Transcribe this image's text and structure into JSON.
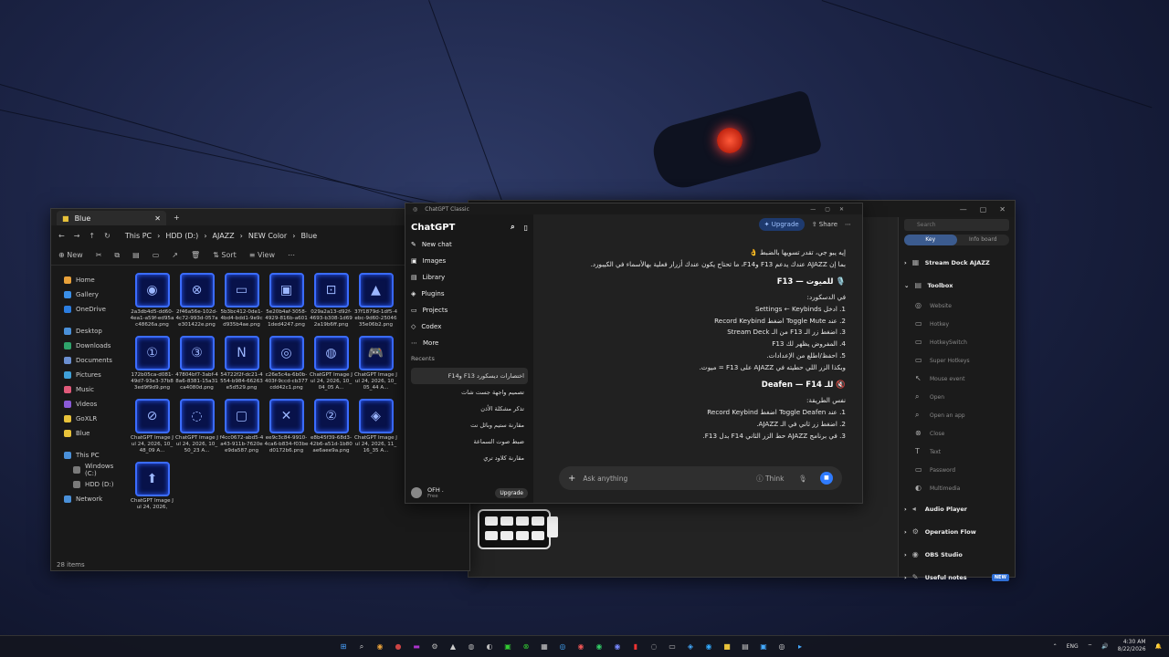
{
  "explorer": {
    "tab_title": "Blue",
    "breadcrumb": [
      "This PC",
      "HDD (D:)",
      "AJAZZ",
      "NEW Color",
      "Blue"
    ],
    "commands": [
      "New",
      "Sort",
      "View"
    ],
    "sidebar": [
      {
        "label": "Home",
        "color": "#e8a13a"
      },
      {
        "label": "Gallery",
        "color": "#3a8fe8"
      },
      {
        "label": "OneDrive",
        "color": "#2b7de0"
      },
      {
        "label": "Desktop",
        "color": "#4a90d9"
      },
      {
        "label": "Downloads",
        "color": "#2fa36b"
      },
      {
        "label": "Documents",
        "color": "#6b8fd1"
      },
      {
        "label": "Pictures",
        "color": "#3fa0d8"
      },
      {
        "label": "Music",
        "color": "#e05a7a"
      },
      {
        "label": "Videos",
        "color": "#8a5ad8"
      },
      {
        "label": "GoXLR",
        "color": "#e8c23a"
      },
      {
        "label": "Blue",
        "color": "#e8c23a"
      },
      {
        "label": "This PC",
        "color": "#4a90d9"
      },
      {
        "label": "Windows (C:)",
        "color": "#7a7a7a"
      },
      {
        "label": "HDD (D:)",
        "color": "#7a7a7a"
      },
      {
        "label": "Network",
        "color": "#4a90d9"
      }
    ],
    "files": [
      {
        "name": "2a3db4d5-dd60-4ea1-a59f-ed95ac48626a.png",
        "glyph": "◉"
      },
      {
        "name": "2f46a56e-102d-4c72-993d-057ae301422e.png",
        "glyph": "⊗"
      },
      {
        "name": "5b3bc412-0de1-4bd4-bdd1-9e9cd935b4ae.png",
        "glyph": "▭"
      },
      {
        "name": "5e20b4af-3058-4929-816b-a6011ded4247.png",
        "glyph": "▣"
      },
      {
        "name": "029a2a13-d92f-4693-b308-1d692a19b6ff.png",
        "glyph": "⊡"
      },
      {
        "name": "37f1879d-1df5-4ebc-9d60-2504635e06b2.png",
        "glyph": "▲"
      },
      {
        "name": "172b05ca-d081-49d7-93e3-37b83ed9f9d9.png",
        "glyph": "①"
      },
      {
        "name": "47804bf7-3abf-48a6-8381-15a31ca4080d.png",
        "glyph": "③"
      },
      {
        "name": "54722f2f-dc21-4554-b984-66263e5d529.png",
        "glyph": "N"
      },
      {
        "name": "c26e5c4a-6b0b-403f-9ccd-cb377cdd42c1.png",
        "glyph": "◎"
      },
      {
        "name": "ChatGPT Image Jul 24, 2026, 10_04_05 A...",
        "glyph": "◍"
      },
      {
        "name": "ChatGPT Image Jul 24, 2026, 10_05_44 A...",
        "glyph": "🎮"
      },
      {
        "name": "ChatGPT Image Jul 24, 2026, 10_48_09 A...",
        "glyph": "⊘"
      },
      {
        "name": "ChatGPT Image Jul 24, 2026, 10_50_23 A...",
        "glyph": "◌"
      },
      {
        "name": "f4cc0672-abd5-4a43-911b-7620ee9da587.png",
        "glyph": "▢"
      },
      {
        "name": "ee9c3c84-9910-4ca6-b834-f03bed0172b6.png",
        "glyph": "✕"
      },
      {
        "name": "e8b45f39-68d3-42b6-a51d-1b80ae6aee9a.png",
        "glyph": "②"
      },
      {
        "name": "ChatGPT Image Jul 24, 2026, 11_16_35 A...",
        "glyph": "◈"
      },
      {
        "name": "ChatGPT Image Jul 24, 2026,",
        "glyph": "⬆"
      }
    ],
    "status": "28 items"
  },
  "streamdock": {
    "search_placeholder": "Search",
    "tabs": [
      "Key",
      "Info board"
    ],
    "categories_top": [
      {
        "label": "Stream Dock AJAZZ",
        "icon": "▦"
      },
      {
        "label": "Toolbox",
        "icon": "▤"
      }
    ],
    "toolbox_items": [
      {
        "label": "Website",
        "icon": "◎"
      },
      {
        "label": "Hotkey",
        "icon": "▭"
      },
      {
        "label": "HotkeySwitch",
        "icon": "▭"
      },
      {
        "label": "Super Hotkeys",
        "icon": "▭"
      },
      {
        "label": "Mouse event",
        "icon": "↖"
      },
      {
        "label": "Open",
        "icon": "⌕"
      },
      {
        "label": "Open an app",
        "icon": "⌕"
      },
      {
        "label": "Close",
        "icon": "⊗"
      },
      {
        "label": "Text",
        "icon": "T"
      },
      {
        "label": "Password",
        "icon": "▭"
      },
      {
        "label": "Multimedia",
        "icon": "◐"
      }
    ],
    "categories_bottom": [
      {
        "label": "Audio Player",
        "icon": "◂"
      },
      {
        "label": "Operation Flow",
        "icon": "⚙"
      },
      {
        "label": "OBS Studio",
        "icon": "◉"
      },
      {
        "label": "Useful notes",
        "icon": "✎",
        "badge": "NEW"
      }
    ]
  },
  "chatgpt": {
    "window_title": "ChatGPT Classic",
    "brand": "ChatGPT",
    "nav": [
      {
        "label": "New chat",
        "icon": "✎"
      },
      {
        "label": "Images",
        "icon": "▣"
      },
      {
        "label": "Library",
        "icon": "▤"
      },
      {
        "label": "Plugins",
        "icon": "◈"
      },
      {
        "label": "Projects",
        "icon": "▭"
      },
      {
        "label": "Codex",
        "icon": "◇"
      },
      {
        "label": "More",
        "icon": "⋯"
      }
    ],
    "recents_label": "Recents",
    "recents": [
      "اختصارات ديسكورد F13 وF14",
      "تصميم واجهة جست شات",
      "تذكر مشكلة الأذن",
      "مقارنة ستيم وبائل نت",
      "ضبط صوت السماعة",
      "مقارنة كلاود تري"
    ],
    "user_name": "OFH .",
    "user_plan": "Free",
    "user_upgrade": "Upgrade",
    "upgrade": "Upgrade",
    "share": "Share",
    "message": {
      "intro": "إيه يبو جي، تقدر تسويها بالضبط 👌",
      "p1": "بما إن AJAZZ عندك يدعم F13 وF14، ما تحتاج يكون عندك أزرار فعلية بهالأسماء في الكيبورد.",
      "h1": "🎙️ للميوت — F13",
      "sub1": "في الدسكورد:",
      "steps1": [
        "1. ادخل Settings ← Keybinds",
        "2. عند Toggle Mute اضغط Record Keybind",
        "3. اضغط زر الـ F13 من الـ Stream Deck",
        "4. المفروض يظهر لك F13",
        "5. احفظ/اطلع من الإعدادات."
      ],
      "p2": "وبكذا الزر اللي حطيته في AJAZZ على F13 = ميوت.",
      "h2": "🔇 للـ Deafen — F14",
      "sub2": "نفس الطريقة:",
      "steps2": [
        "1. عند Toggle Deafen اضغط Record Keybind",
        "2. اضغط زر ثاني في الـ AJAZZ.",
        "3. في برنامج AJAZZ حط الزر الثاني F14 بدل F13."
      ]
    },
    "composer_placeholder": "Ask anything",
    "think": "Think"
  },
  "taskbar": {
    "lang": "ENG",
    "time": "4:30 AM",
    "date": "8/22/2026"
  }
}
